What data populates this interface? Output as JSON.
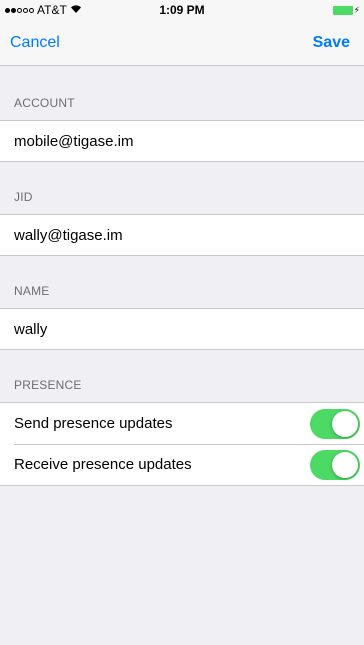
{
  "status_bar": {
    "carrier": "AT&T",
    "wifi_icon": "wifi-icon",
    "time": "1:09 PM",
    "battery_icon": "battery-icon"
  },
  "navbar": {
    "cancel_label": "Cancel",
    "save_label": "Save"
  },
  "sections": {
    "account": {
      "header": "ACCOUNT",
      "value": "mobile@tigase.im"
    },
    "jid": {
      "header": "JID",
      "value": "wally@tigase.im"
    },
    "name": {
      "header": "NAME",
      "value": "wally"
    },
    "presence": {
      "header": "PRESENCE",
      "rows": [
        {
          "label": "Send presence updates",
          "on": true
        },
        {
          "label": "Receive presence updates",
          "on": true
        }
      ]
    }
  },
  "colors": {
    "accent": "#007aff",
    "switch_on": "#4cd964",
    "background": "#efeff4"
  }
}
